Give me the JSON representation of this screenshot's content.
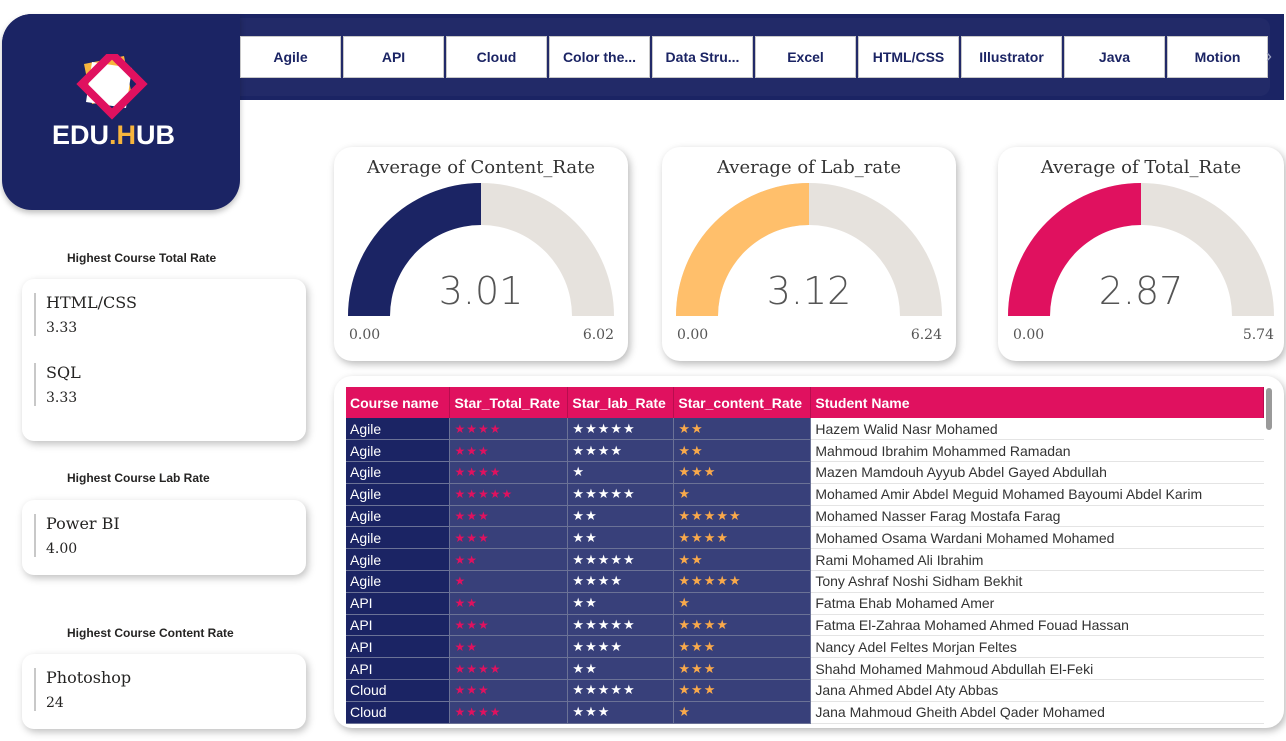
{
  "logo": {
    "text_main": "EDU",
    "text_dot": ".",
    "text_h": "H",
    "text_rest": "UB"
  },
  "slicer": {
    "items": [
      "Agile",
      "API",
      "Cloud",
      "Color the...",
      "Data Stru...",
      "Excel",
      "HTML/CSS",
      "Illustrator",
      "Java",
      "Motion"
    ],
    "next_icon": "chevron-right-icon"
  },
  "gauges": [
    {
      "title": "Average of Content_Rate",
      "value": "3.01",
      "min": "0.00",
      "max": "6.02",
      "fraction": 0.5,
      "color": "#1b2464"
    },
    {
      "title": "Average of Lab_rate",
      "value": "3.12",
      "min": "0.00",
      "max": "6.24",
      "fraction": 0.5,
      "color": "#ffbf6b"
    },
    {
      "title": "Average of Total_Rate",
      "value": "2.87",
      "min": "0.00",
      "max": "5.74",
      "fraction": 0.5,
      "color": "#e0115f"
    }
  ],
  "track_color": "#e6e2dd",
  "side": {
    "total": {
      "label": "Highest Course Total Rate",
      "items": [
        {
          "name": "HTML/CSS",
          "value": "3.33"
        },
        {
          "name": "SQL",
          "value": "3.33"
        }
      ]
    },
    "lab": {
      "label": "Highest Course Lab Rate",
      "items": [
        {
          "name": "Power BI",
          "value": "4.00"
        }
      ]
    },
    "content": {
      "label": "Highest Course Content Rate",
      "items": [
        {
          "name": "Photoshop",
          "value": "24"
        }
      ]
    }
  },
  "table": {
    "columns": [
      "Course name",
      "Star_Total_Rate",
      "Star_lab_Rate",
      "Star_content_Rate",
      "Student Name"
    ],
    "rows": [
      [
        "Agile",
        "★★★★",
        "★★★★★",
        "★★",
        "Hazem Walid Nasr Mohamed"
      ],
      [
        "Agile",
        "★★★",
        "★★★★",
        "★★",
        "Mahmoud Ibrahim Mohammed Ramadan"
      ],
      [
        "Agile",
        "★★★★",
        "★",
        "★★★",
        "Mazen Mamdouh Ayyub Abdel Gayed Abdullah"
      ],
      [
        "Agile",
        "★★★★★",
        "★★★★★",
        "★",
        "Mohamed Amir Abdel Meguid Mohamed Bayoumi Abdel Karim"
      ],
      [
        "Agile",
        "★★★",
        "★★",
        "★★★★★",
        "Mohamed Nasser Farag Mostafa Farag"
      ],
      [
        "Agile",
        "★★★",
        "★★",
        "★★★★",
        "Mohamed Osama Wardani Mohamed Mohamed"
      ],
      [
        "Agile",
        "★★",
        "★★★★★",
        "★★",
        "Rami Mohamed Ali Ibrahim"
      ],
      [
        "Agile",
        "★",
        "★★★★",
        "★★★★★",
        "Tony Ashraf Noshi Sidham Bekhit"
      ],
      [
        "API",
        "★★",
        "★★",
        "★",
        "Fatma Ehab Mohamed Amer"
      ],
      [
        "API",
        "★★★",
        "★★★★★",
        "★★★★",
        "Fatma El-Zahraa Mohamed Ahmed Fouad Hassan"
      ],
      [
        "API",
        "★★",
        "★★★★",
        "★★★",
        "Nancy Adel Feltes Morjan Feltes"
      ],
      [
        "API",
        "★★★★",
        "★★",
        "★★★",
        "Shahd Mohamed Mahmoud Abdullah El-Feki"
      ],
      [
        "Cloud",
        "★★★",
        "★★★★★",
        "★★★",
        "Jana Ahmed Abdel Aty Abbas"
      ],
      [
        "Cloud",
        "★★★★",
        "★★★",
        "★",
        "Jana Mahmoud Gheith Abdel Qader Mohamed"
      ]
    ]
  }
}
